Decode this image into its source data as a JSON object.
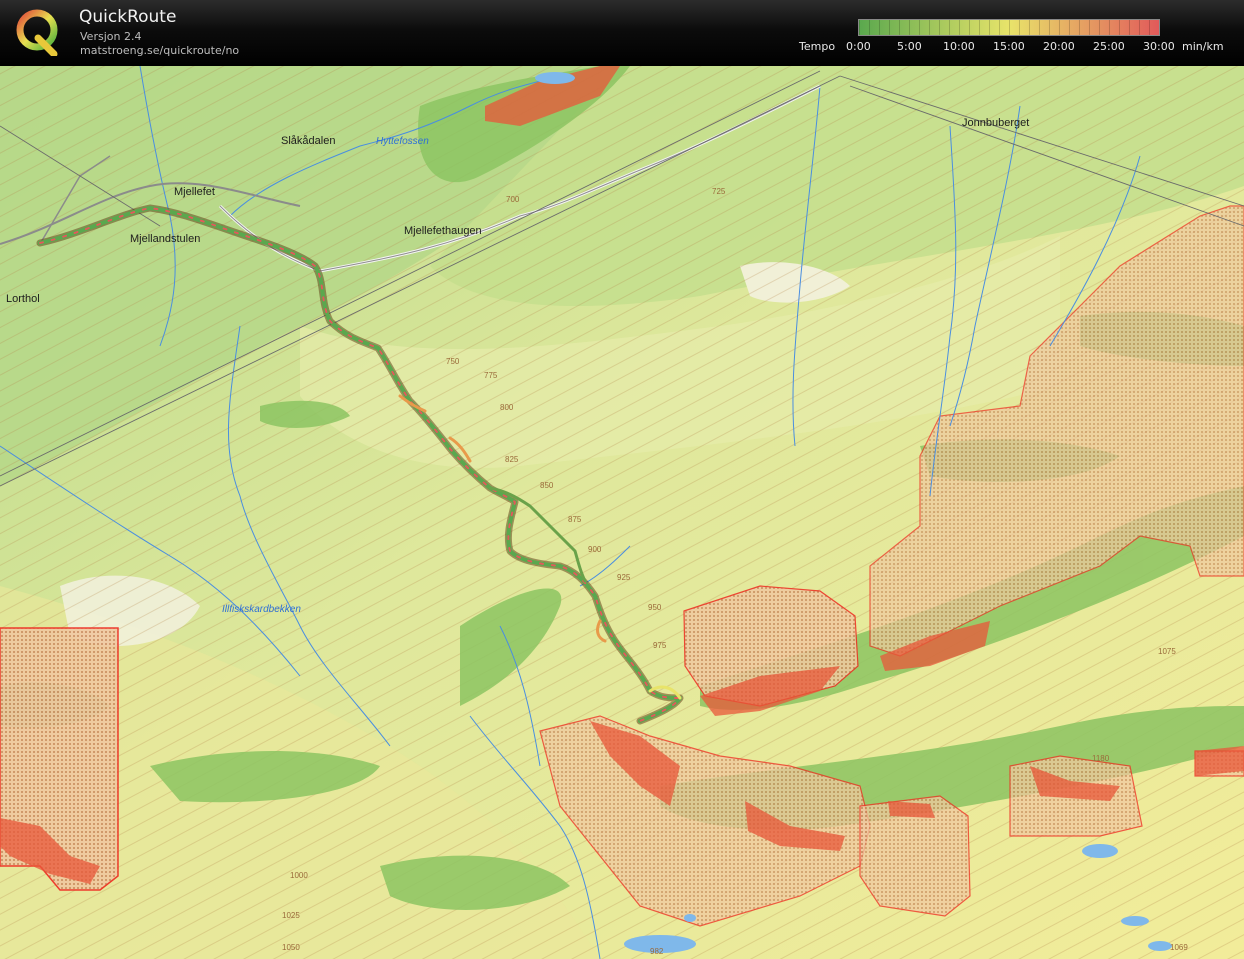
{
  "app": {
    "title": "QuickRoute",
    "version": "Versjon 2.4",
    "url": "matstroeng.se/quickroute/no"
  },
  "legend": {
    "title": "Tempo",
    "ticks": [
      "0:00",
      "5:00",
      "10:00",
      "15:00",
      "20:00",
      "25:00",
      "30:00"
    ],
    "tick_values": [
      0,
      5,
      10,
      15,
      20,
      25,
      30
    ],
    "unit": "min/km",
    "colors": {
      "slow": "#e25a5a",
      "mid": "#e8e46a",
      "fast": "#5aa84e"
    }
  },
  "map": {
    "place_names": [
      {
        "name": "Slåkådalen"
      },
      {
        "name": "Mjellefet"
      },
      {
        "name": "Mjellandstulen"
      },
      {
        "name": "Mjellefethaugen"
      },
      {
        "name": "Jonnbuberget"
      },
      {
        "name": "Lorthol"
      }
    ],
    "water_names": [
      {
        "name": "Hyttefossen"
      },
      {
        "name": "Illfiskskardbekken"
      }
    ],
    "elevations": [
      {
        "value": "700"
      },
      {
        "value": "725"
      },
      {
        "value": "750"
      },
      {
        "value": "775"
      },
      {
        "value": "800"
      },
      {
        "value": "825"
      },
      {
        "value": "850"
      },
      {
        "value": "875"
      },
      {
        "value": "900"
      },
      {
        "value": "925"
      },
      {
        "value": "950"
      },
      {
        "value": "975"
      },
      {
        "value": "1000"
      },
      {
        "value": "1025"
      },
      {
        "value": "1050"
      },
      {
        "value": "1075"
      },
      {
        "value": "1069"
      },
      {
        "value": "1180"
      },
      {
        "value": "982"
      }
    ]
  }
}
